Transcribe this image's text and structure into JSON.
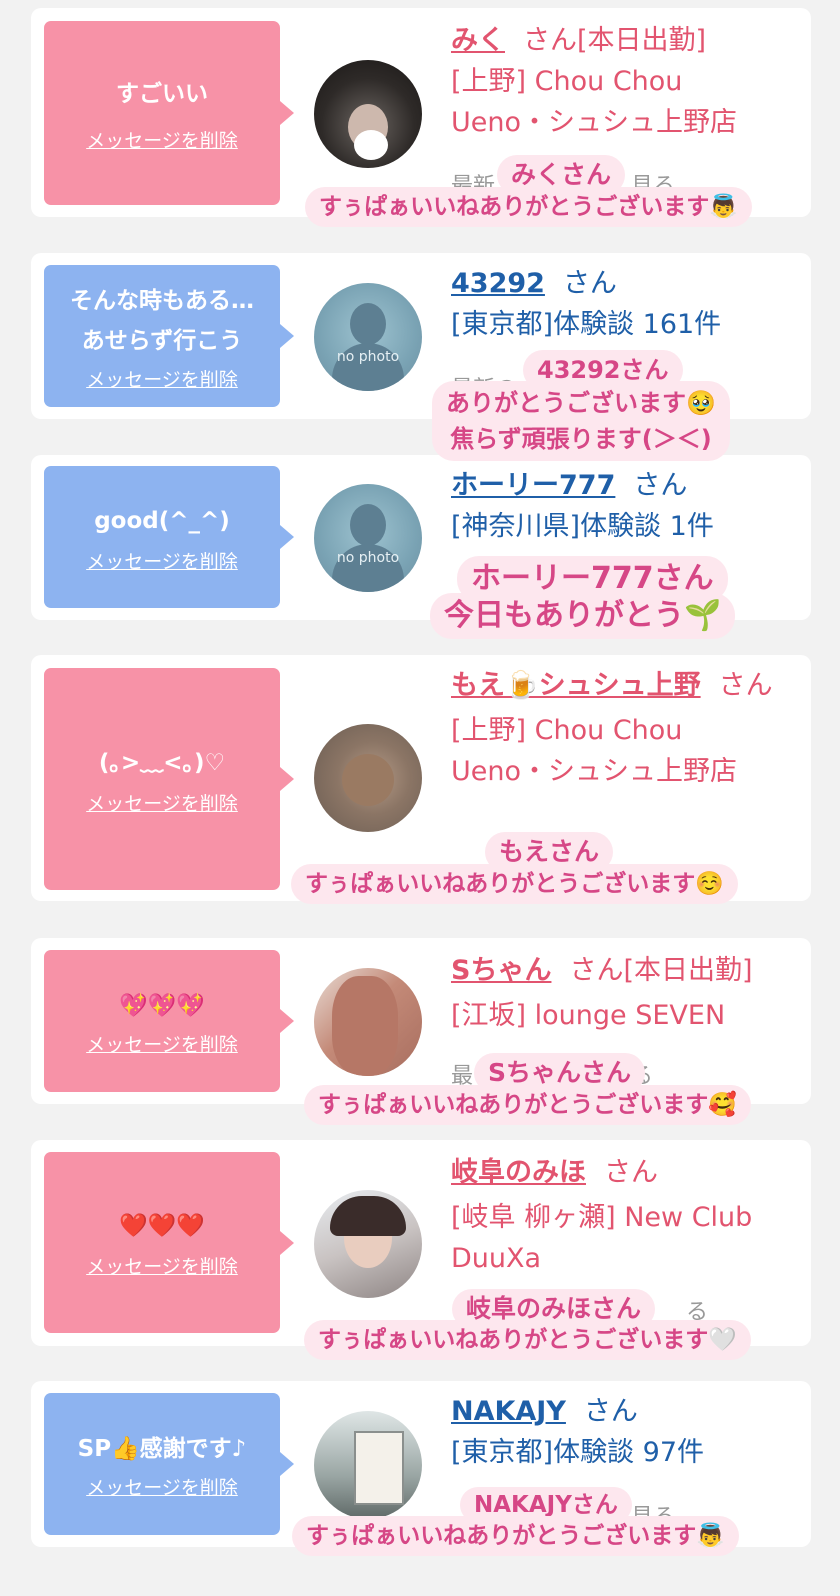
{
  "delete_label": "メッセージを削除",
  "san": "さん",
  "no_photo": "no photo",
  "cards": [
    {
      "message": "すごいい",
      "name": "みく",
      "extra": "[本日出勤]",
      "line1": "[上野] Chou Chou",
      "line2": "Ueno・シュシュ上野店",
      "sub": "最新",
      "sub2": "見る",
      "over_name": "みくさん",
      "over_msg": "すぅぱぁいいねありがとうございます👼"
    },
    {
      "message": "そんな時もある…\nあせらず行こう",
      "name": "43292",
      "line1": "[東京都]体験談 161件",
      "sub": "最新の",
      "over_name": "43292さん",
      "over_msg": "ありがとうございます🥹\n焦らず頑張ります(＞＜)"
    },
    {
      "message": "good(^_^)",
      "name": "ホーリー777",
      "line1": "[神奈川県]体験談 1件",
      "over_name": "ホーリー777さん",
      "over_msg": "今日もありがとう🌱"
    },
    {
      "message": "(｡>﹏<｡)♡",
      "name": "もえ🍺シュシュ上野",
      "line1": "[上野] Chou Chou",
      "line2": "Ueno・シュシュ上野店",
      "over_name": "もえさん",
      "over_msg": "すぅぱぁいいねありがとうございます☺️"
    },
    {
      "message": "💖💖💖",
      "name": "Sちゃん",
      "extra": "[本日出勤]",
      "line1": "[江坂] lounge SEVEN",
      "sub": "最",
      "sub2": "る",
      "over_name": "Sちゃんさん",
      "over_msg": "すぅぱぁいいねありがとうございます🥰"
    },
    {
      "message": "❤️❤️❤️",
      "name": "岐阜のみほ",
      "line1": "[岐阜 柳ヶ瀬] New Club",
      "line2": "DuuXa",
      "sub2": "る",
      "over_name": "岐阜のみほさん",
      "over_msg": "すぅぱぁいいねありがとうございます🤍"
    },
    {
      "message": "SP👍感謝です♪",
      "name": "NAKAJY",
      "line1": "[東京都]体験談 97件",
      "sub2": "見る",
      "over_name": "NAKAJYさん",
      "over_msg": "すぅぱぁいいねありがとうございます👼"
    }
  ]
}
